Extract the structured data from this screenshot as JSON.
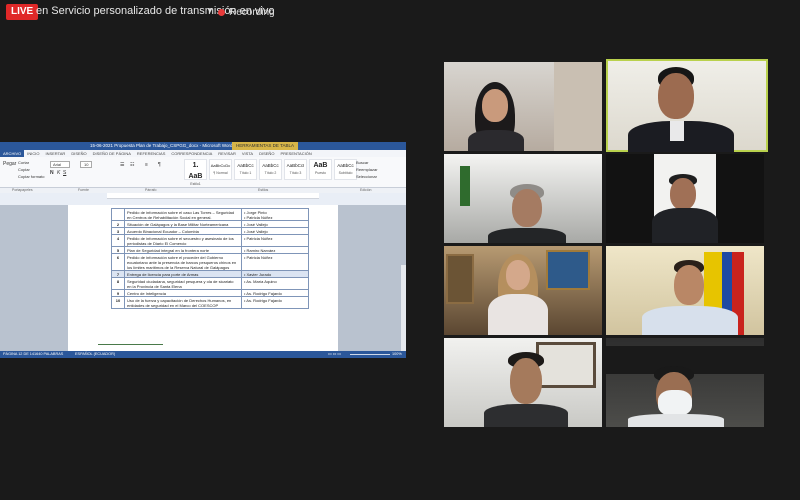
{
  "topbar": {
    "live_label": "LIVE",
    "stream_title": "en Servicio personalizado de transmisión en vivo",
    "dropdown_icon": "chevron-down-icon",
    "recording_label": "Recording"
  },
  "word": {
    "title": "15-06-2021 Propuesta Plan de Trabajo_CSPGG_docx - Microsoft Word",
    "context_tab": "HERRAMIENTAS DE TABLA",
    "tabs": [
      "ARCHIVO",
      "INICIO",
      "INSERTAR",
      "DISEÑO",
      "DISEÑO DE PÁGINA",
      "REFERENCIAS",
      "CORRESPONDENCIA",
      "REVISAR",
      "VISTA",
      "DISEÑO",
      "PRESENTACIÓN"
    ],
    "font_name": "Arial",
    "font_size": "10",
    "clipboard": {
      "paste": "Pegar",
      "cut": "Cortar",
      "copy": "Copiar",
      "format": "Copiar formato"
    },
    "styles": [
      {
        "sample": "1. AaB",
        "name": "Estilo1"
      },
      {
        "sample": "AaBbCcDc",
        "name": "¶ Normal"
      },
      {
        "sample": "AaBbCc",
        "name": "Título 1"
      },
      {
        "sample": "AaBbCc",
        "name": "Título 2"
      },
      {
        "sample": "AaBbCcI",
        "name": "Título 3"
      },
      {
        "sample": "AaB",
        "name": "Puesto"
      },
      {
        "sample": "AaBbCc",
        "name": "Subtítulo"
      }
    ],
    "editing": {
      "find": "Buscar",
      "replace": "Reemplazar",
      "select": "Seleccionar"
    },
    "group_labels": [
      "Portapapeles",
      "Fuente",
      "Párrafo",
      "Estilos",
      "Edición"
    ],
    "table_rows": [
      {
        "n": "",
        "activity": "Pedido de información sobre el caso Las Torres – Seguridad en Centros de Rehabilitación Social en general.",
        "owner": "Jorge Pinto\nPatricia Núñez"
      },
      {
        "n": "2",
        "activity": "Situación de Galápagos y la Base Militar Norteamericana",
        "owner": "José Vallejo"
      },
      {
        "n": "3",
        "activity": "Acuerdo Binacional Ecuador – Colombia",
        "owner": "José Vallejo"
      },
      {
        "n": "4",
        "activity": "Pedido de información sobre el secuestro y asesinato de los periodistas de Diario El Comercio",
        "owner": "Patricia Núñez"
      },
      {
        "n": "5",
        "activity": "Plan de Seguridad integral en la frontera norte",
        "owner": "Ramiro Narváez"
      },
      {
        "n": "6",
        "activity": "Pedido de información sobre el proceder del Gobierno ecuatoriano ante la presencia de barcos pesqueros chinos en los límites marítimos de la Reserva Natural de Galápagos",
        "owner": "Patricia Núñez"
      },
      {
        "n": "7",
        "activity": "Entrega de licencia para porte de Armas",
        "owner": "Xavier Jurado"
      },
      {
        "n": "8",
        "activity": "Seguridad ciudadana, seguridad pesquera y ola de sicariato en la Provincia de Santa Elena",
        "owner": "As. María Aquino"
      },
      {
        "n": "9",
        "activity": "Centro de Inteligencia",
        "owner": "As. Rodrigo Fajardo"
      },
      {
        "n": "10",
        "activity": "Uso de la fuerza y capacitación de Derechos Humanos, en entidades de seguridad en el Marco del COESCOP",
        "owner": "As. Rodrigo Fajardo"
      }
    ],
    "status": {
      "page": "PÁGINA 12 DE 14",
      "words": "1640 PALABRAS",
      "language": "ESPAÑOL (ECUADOR)",
      "zoom": "100%"
    }
  },
  "participants": [
    {
      "id": "p1",
      "active": false
    },
    {
      "id": "p2",
      "active": true
    },
    {
      "id": "p3",
      "active": false
    },
    {
      "id": "p4",
      "active": false
    },
    {
      "id": "p5",
      "active": false
    },
    {
      "id": "p6",
      "active": false
    },
    {
      "id": "p7",
      "active": false
    },
    {
      "id": "p8",
      "active": false
    }
  ]
}
